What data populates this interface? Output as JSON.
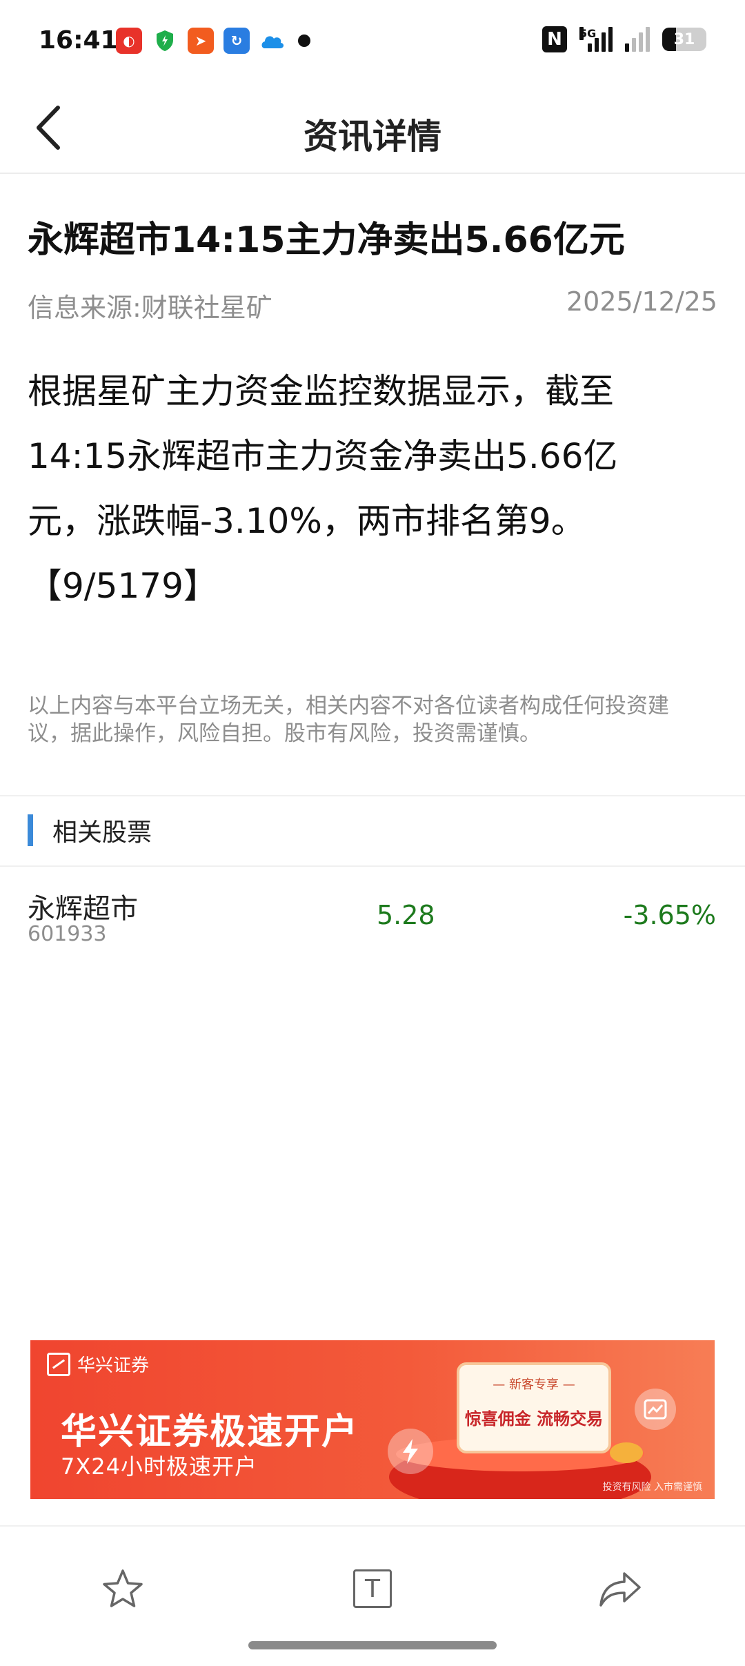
{
  "status_bar": {
    "time": "16:41",
    "network": "5G",
    "battery": "31"
  },
  "nav": {
    "title": "资讯详情"
  },
  "article": {
    "headline": "永辉超市14:15主力净卖出5.66亿元",
    "source": "信息来源:财联社星矿",
    "date": "2025/12/25",
    "body_line1": "根据星矿主力资金监控数据显示，截至",
    "body_line2": "14:15永辉超市主力资金净卖出5.66亿",
    "body_line3": "元，涨跌幅-3.10%，两市排名第9。",
    "body_line4": "【9/5179】",
    "disclaimer_line1": "以上内容与本平台立场无关，相关内容不对各位读者构成任何投资建",
    "disclaimer_line2": "议，据此操作，风险自担。股市有风险，投资需谨慎。"
  },
  "related": {
    "title": "相关股票",
    "stocks": [
      {
        "name": "永辉超市",
        "code": "601933",
        "price": "5.28",
        "change": "-3.65%"
      }
    ]
  },
  "banner": {
    "brand": "华兴证券",
    "title": "华兴证券极速开户",
    "subtitle": "7X24小时极速开户",
    "card_top": "— 新客专享 —",
    "card_main": "惊喜佣金 流畅交易",
    "note": "投资有风险 入市需谨慎"
  },
  "toolbar": {
    "text_icon_glyph": "T"
  },
  "colors": {
    "accent_blue": "#3b8ad9",
    "stock_green": "#1d7a1d",
    "banner_red": "#f0452f"
  },
  "icons": [
    "back-arrow-icon",
    "star-icon",
    "text-size-icon",
    "share-icon",
    "nfc-icon",
    "signal-icon",
    "battery-icon"
  ]
}
